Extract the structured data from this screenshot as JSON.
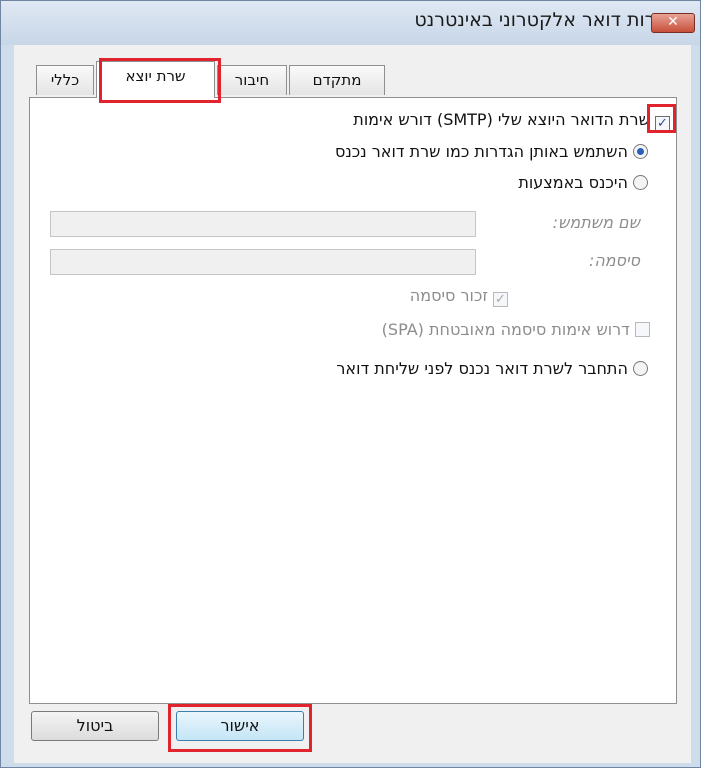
{
  "window": {
    "title": "הגדרות דואר אלקטרוני באינטרנט",
    "close_label": "✕"
  },
  "tabs": [
    {
      "label": "כללי",
      "active": false
    },
    {
      "label": "שרת יוצא",
      "active": true
    },
    {
      "label": "חיבור",
      "active": false
    },
    {
      "label": "מתקדם",
      "active": false
    }
  ],
  "outgoing": {
    "smtp_auth_label": "שרת הדואר היוצא שלי (SMTP) דורש אימות",
    "smtp_auth_checked": true,
    "use_same_label": "השתמש באותן הגדרות כמו שרת דואר נכנס",
    "logon_using_label": "היכנס באמצעות",
    "username_label": "שם משתמש:",
    "username_value": "",
    "password_label": "סיסמה:",
    "password_value": "",
    "remember_password_label": "זכור סיסמה",
    "remember_password_checked": true,
    "require_spa_label": "דרוש אימות סיסמה מאובטחת (SPA)",
    "require_spa_checked": false,
    "logon_before_label": "התחבר לשרת דואר נכנס לפני שליחת דואר",
    "selected_option": "use_same"
  },
  "buttons": {
    "ok_label": "אישור",
    "cancel_label": "ביטול"
  },
  "colors": {
    "highlight": "#e0232d",
    "titlebar": "#cfdcec",
    "close": "#c7503b"
  }
}
